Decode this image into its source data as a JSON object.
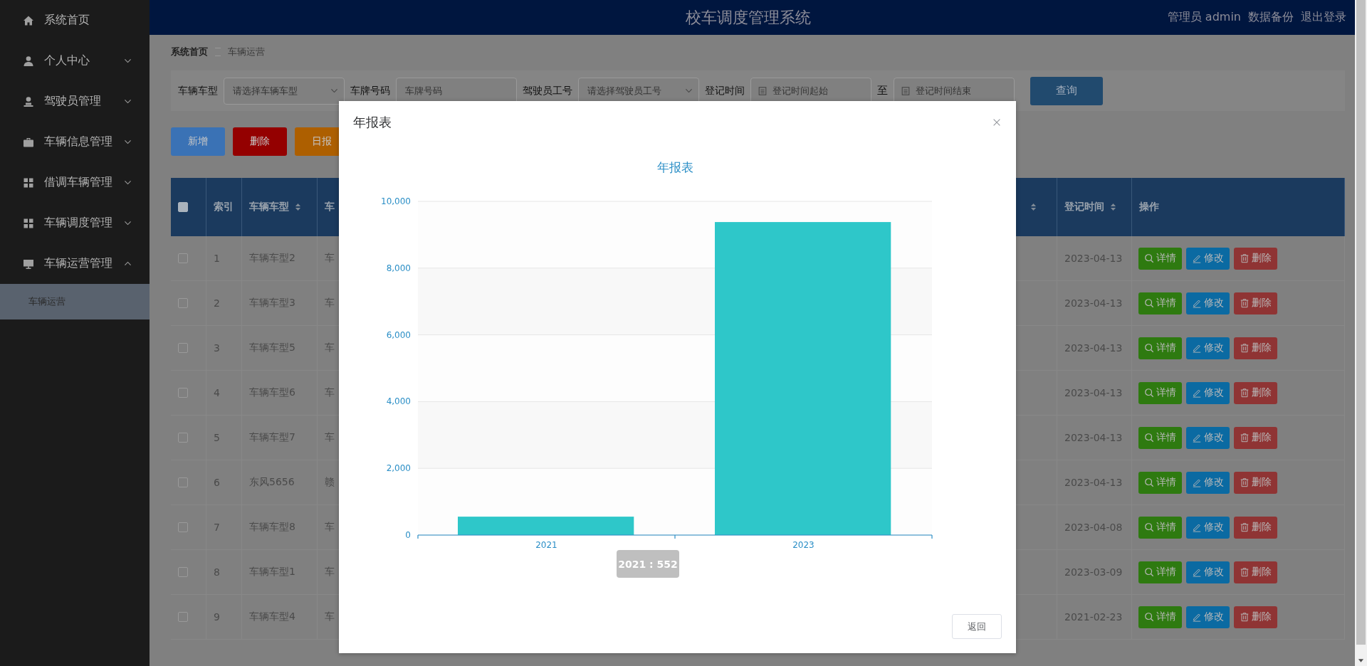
{
  "header": {
    "title": "校车调度管理系统",
    "user": "管理员 admin",
    "links": [
      "数据备份",
      "退出登录"
    ]
  },
  "sidebar": {
    "items": [
      {
        "label": "系统首页",
        "kind": "link"
      },
      {
        "label": "个人中心",
        "kind": "menu",
        "expanded": false
      },
      {
        "label": "驾驶员管理",
        "kind": "menu",
        "expanded": false
      },
      {
        "label": "车辆信息管理",
        "kind": "menu",
        "expanded": false
      },
      {
        "label": "借调车辆管理",
        "kind": "menu",
        "expanded": false
      },
      {
        "label": "车辆调度管理",
        "kind": "menu",
        "expanded": false
      },
      {
        "label": "车辆运营管理",
        "kind": "menu",
        "expanded": true,
        "children": [
          {
            "label": "车辆运营",
            "selected": true
          }
        ]
      }
    ]
  },
  "breadcrumb": [
    "系统首页",
    "车辆运营"
  ],
  "filters": [
    {
      "label": "车辆车型",
      "kind": "select",
      "placeholder": "请选择车辆车型"
    },
    {
      "label": "车牌号码",
      "kind": "input",
      "placeholder": "车牌号码"
    },
    {
      "label": "驾驶员工号",
      "kind": "select",
      "placeholder": "请选择驾驶员工号"
    },
    {
      "label": "登记时间",
      "kind": "date-range",
      "placeholder": "登记时间起始",
      "separator": "至",
      "placeholder_end": "登记时间结束"
    }
  ],
  "search_button": "查询",
  "actions": [
    {
      "label": "新增",
      "color": "#3a72b5"
    },
    {
      "label": "删除",
      "color": "#940000"
    },
    {
      "label": "日报",
      "color": "#ad5f00"
    }
  ],
  "table": {
    "columns": [
      {
        "kind": "checkbox",
        "checked": false
      },
      {
        "kind": "text",
        "label": "索引",
        "sortable": false
      },
      {
        "kind": "text",
        "label": "车辆车型",
        "sortable": true
      },
      {
        "kind": "text",
        "label": "车"
      },
      {
        "kind": "text",
        "sortable": true
      },
      {
        "kind": "text",
        "label": "登记时间",
        "sortable": true
      },
      {
        "kind": "text",
        "label": "操作",
        "sortable": false
      }
    ],
    "rows": [
      {
        "checked": false,
        "index": "1",
        "vehicle_type": "车辆车型2",
        "column_4": "车",
        "date": "2023-04-13",
        "actions": [
          {
            "label": "详情",
            "color": "#2e7a10"
          },
          {
            "label": "修改",
            "color": "#0b6aa2"
          },
          {
            "label": "删除",
            "color": "#8f3434"
          }
        ]
      },
      {
        "checked": false,
        "index": "2",
        "vehicle_type": "车辆车型3",
        "column_4": "车",
        "date": "2023-04-13",
        "actions": [
          {
            "label": "详情",
            "color": "#2e7a10"
          },
          {
            "label": "修改",
            "color": "#0b6aa2"
          },
          {
            "label": "删除",
            "color": "#8f3434"
          }
        ]
      },
      {
        "checked": false,
        "index": "3",
        "vehicle_type": "车辆车型5",
        "column_4": "车",
        "date": "2023-04-13",
        "actions": [
          {
            "label": "详情",
            "color": "#2e7a10"
          },
          {
            "label": "修改",
            "color": "#0b6aa2"
          },
          {
            "label": "删除",
            "color": "#8f3434"
          }
        ]
      },
      {
        "checked": false,
        "index": "4",
        "vehicle_type": "车辆车型6",
        "column_4": "车",
        "date": "2023-04-13",
        "actions": [
          {
            "label": "详情",
            "color": "#2e7a10"
          },
          {
            "label": "修改",
            "color": "#0b6aa2"
          },
          {
            "label": "删除",
            "color": "#8f3434"
          }
        ]
      },
      {
        "checked": false,
        "index": "5",
        "vehicle_type": "车辆车型7",
        "column_4": "车",
        "date": "2023-04-13",
        "actions": [
          {
            "label": "详情",
            "color": "#2e7a10"
          },
          {
            "label": "修改",
            "color": "#0b6aa2"
          },
          {
            "label": "删除",
            "color": "#8f3434"
          }
        ]
      },
      {
        "checked": false,
        "index": "6",
        "vehicle_type": "东风5656",
        "column_4": "赣",
        "date": "2023-04-13",
        "actions": [
          {
            "label": "详情",
            "color": "#2e7a10"
          },
          {
            "label": "修改",
            "color": "#0b6aa2"
          },
          {
            "label": "删除",
            "color": "#8f3434"
          }
        ]
      },
      {
        "checked": false,
        "index": "7",
        "vehicle_type": "车辆车型8",
        "column_4": "车",
        "date": "2023-04-08",
        "actions": [
          {
            "label": "详情",
            "color": "#2e7a10"
          },
          {
            "label": "修改",
            "color": "#0b6aa2"
          },
          {
            "label": "删除",
            "color": "#8f3434"
          }
        ]
      },
      {
        "checked": false,
        "index": "8",
        "vehicle_type": "车辆车型1",
        "column_4": "车",
        "date": "2023-03-09",
        "actions": [
          {
            "label": "详情",
            "color": "#2e7a10"
          },
          {
            "label": "修改",
            "color": "#0b6aa2"
          },
          {
            "label": "删除",
            "color": "#8f3434"
          }
        ]
      },
      {
        "checked": false,
        "index": "9",
        "vehicle_type": "车辆车型4",
        "column_4": "车",
        "date": "2021-02-23",
        "actions": [
          {
            "label": "详情",
            "color": "#2e7a10"
          },
          {
            "label": "修改",
            "color": "#0b6aa2"
          },
          {
            "label": "删除",
            "color": "#8f3434"
          }
        ]
      }
    ]
  },
  "modal": {
    "title": "年报表",
    "chart_data": {
      "type": "bar",
      "title": "年报表",
      "categories": [
        "2021",
        "2023"
      ],
      "series": [
        {
          "color": "#2ec7c9",
          "values": [
            552,
            9380
          ]
        }
      ],
      "grid": true,
      "ylim": [
        0,
        10000
      ],
      "yticks": [
        {
          "value": 0,
          "label": "0"
        },
        {
          "value": 2000,
          "label": "2,000"
        },
        {
          "value": 4000,
          "label": "4,000"
        },
        {
          "value": 6000,
          "label": "6,000"
        },
        {
          "value": 8000,
          "label": "8,000"
        },
        {
          "value": 10000,
          "label": "10,000"
        }
      ]
    },
    "tooltip": "2021 : 552",
    "buttons": [
      "返回"
    ]
  }
}
